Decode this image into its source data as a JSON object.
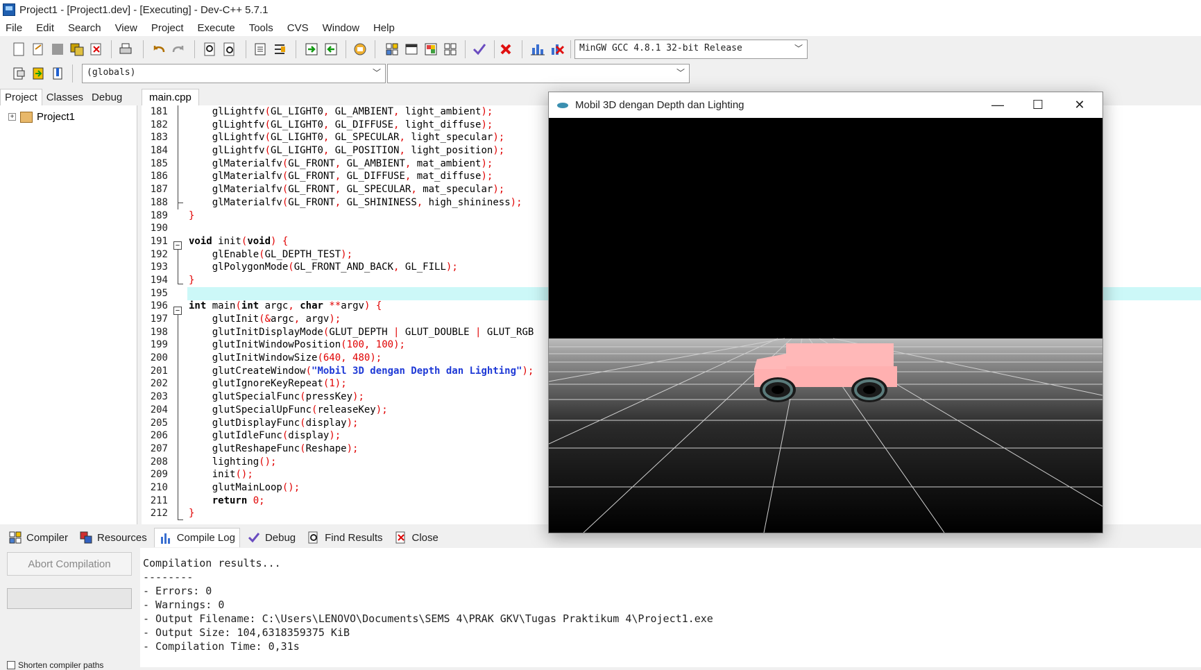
{
  "window": {
    "title": "Project1 - [Project1.dev] - [Executing] - Dev-C++ 5.7.1"
  },
  "menu": [
    "File",
    "Edit",
    "Search",
    "View",
    "Project",
    "Execute",
    "Tools",
    "CVS",
    "Window",
    "Help"
  ],
  "toolbar": {
    "compiler_select": "MinGW GCC 4.8.1 32-bit Release",
    "scope_select": "(globals)",
    "symbol_select": ""
  },
  "left_tabs": [
    "Project",
    "Classes",
    "Debug"
  ],
  "tree": {
    "project": "Project1"
  },
  "editor": {
    "tab": "main.cpp",
    "line_numbers": [
      "181",
      "182",
      "183",
      "184",
      "185",
      "186",
      "187",
      "188",
      "189",
      "190",
      "191",
      "192",
      "193",
      "194",
      "195",
      "196",
      "197",
      "198",
      "199",
      "200",
      "201",
      "202",
      "203",
      "204",
      "205",
      "206",
      "207",
      "208",
      "209",
      "210",
      "211",
      "212"
    ],
    "lines": [
      "    glLightfv(GL_LIGHT0, GL_AMBIENT, light_ambient);",
      "    glLightfv(GL_LIGHT0, GL_DIFFUSE, light_diffuse);",
      "    glLightfv(GL_LIGHT0, GL_SPECULAR, light_specular);",
      "    glLightfv(GL_LIGHT0, GL_POSITION, light_position);",
      "    glMaterialfv(GL_FRONT, GL_AMBIENT, mat_ambient);",
      "    glMaterialfv(GL_FRONT, GL_DIFFUSE, mat_diffuse);",
      "    glMaterialfv(GL_FRONT, GL_SPECULAR, mat_specular);",
      "    glMaterialfv(GL_FRONT, GL_SHININESS, high_shininess);",
      "}",
      "",
      "void init(void) {",
      "    glEnable(GL_DEPTH_TEST);",
      "    glPolygonMode(GL_FRONT_AND_BACK, GL_FILL);",
      "}",
      "",
      "int main(int argc, char **argv) {",
      "    glutInit(&argc, argv);",
      "    glutInitDisplayMode(GLUT_DEPTH | GLUT_DOUBLE | GLUT_RGB",
      "    glutInitWindowPosition(100, 100);",
      "    glutInitWindowSize(640, 480);",
      "    glutCreateWindow(\"Mobil 3D dengan Depth dan Lighting\");",
      "    glutIgnoreKeyRepeat(1);",
      "    glutSpecialFunc(pressKey);",
      "    glutSpecialUpFunc(releaseKey);",
      "    glutDisplayFunc(display);",
      "    glutIdleFunc(display);",
      "    glutReshapeFunc(Reshape);",
      "    lighting();",
      "    init();",
      "    glutMainLoop();",
      "    return 0;",
      "}"
    ]
  },
  "bottom_tabs": [
    "Compiler",
    "Resources",
    "Compile Log",
    "Debug",
    "Find Results",
    "Close"
  ],
  "bottom": {
    "abort_label": "Abort Compilation",
    "shorten_label": "Shorten compiler paths",
    "log": [
      "Compilation results...",
      "--------",
      "- Errors: 0",
      "- Warnings: 0",
      "- Output Filename: C:\\Users\\LENOVO\\Documents\\SEMS 4\\PRAK GKV\\Tugas Praktikum 4\\Project1.exe",
      "- Output Size: 104,6318359375 KiB",
      "- Compilation Time: 0,31s"
    ]
  },
  "gl_window": {
    "title": "Mobil 3D dengan Depth dan Lighting"
  },
  "colors": {
    "car_body": "#ffb3b3",
    "highlight_line": "#ccf8f8",
    "keyword_red": "#e00000",
    "string_blue": "#1f3ad6"
  }
}
